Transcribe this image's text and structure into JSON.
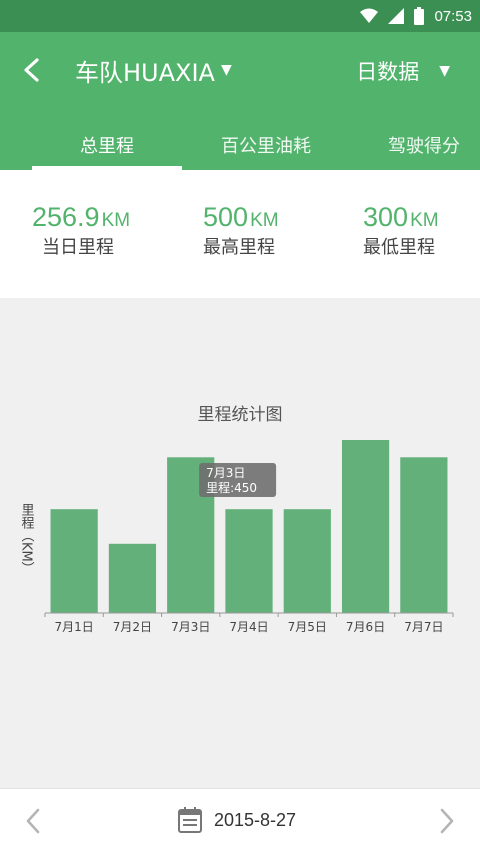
{
  "status_bar": {
    "time": "07:53"
  },
  "header": {
    "team_title": "车队HUAXIA",
    "data_type": "日数据"
  },
  "tabs": [
    {
      "label": "总里程",
      "active": true
    },
    {
      "label": "百公里油耗",
      "active": false
    },
    {
      "label": "驾驶得分",
      "active": false
    }
  ],
  "summary": [
    {
      "value": "256.9",
      "unit": "KM",
      "label": "当日里程"
    },
    {
      "value": "500",
      "unit": "KM",
      "label": "最高里程"
    },
    {
      "value": "300",
      "unit": "KM",
      "label": "最低里程"
    }
  ],
  "chart_data": {
    "type": "bar",
    "title": "里程统计图",
    "ylabel": "里程（KM）",
    "categories": [
      "7月1日",
      "7月2日",
      "7月3日",
      "7月4日",
      "7月5日",
      "7月6日",
      "7月7日"
    ],
    "values": [
      300,
      200,
      450,
      300,
      300,
      500,
      450
    ],
    "ylim": [
      0,
      500
    ],
    "tooltip": {
      "line1": "7月3日",
      "line2": "里程:450",
      "index": 2
    },
    "bar_color": "#63b07a"
  },
  "footer": {
    "date": "2015-8-27"
  },
  "colors": {
    "primary": "#52b36c",
    "status_bar": "#3c8f52"
  }
}
